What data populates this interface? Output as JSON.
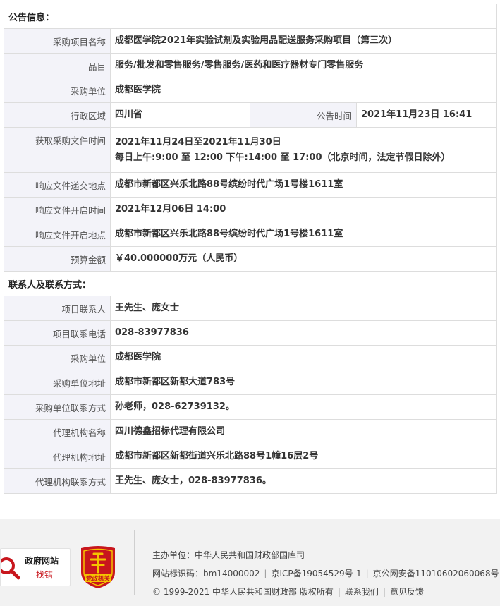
{
  "notice": {
    "section_title": "公告信息：",
    "project_name_label": "采购项目名称",
    "project_name": "成都医学院2021年实验试剂及实验用品配送服务采购项目（第三次）",
    "category_label": "品目",
    "category": "服务/批发和零售服务/零售服务/医药和医疗器材专门零售服务",
    "purchaser_label": "采购单位",
    "purchaser": "成都医学院",
    "region_label": "行政区域",
    "region": "四川省",
    "announce_time_label": "公告时间",
    "announce_time": "2021年11月23日 16:41",
    "doc_time_label": "获取采购文件时间",
    "doc_time_line1": "2021年11月24日至2021年11月30日",
    "doc_time_line2": "每日上午:9:00 至 12:00  下午:14:00 至 17:00（北京时间，法定节假日除外）",
    "submit_place_label": "响应文件递交地点",
    "submit_place": "成都市新都区兴乐北路88号缤纷时代广场1号楼1611室",
    "open_time_label": "响应文件开启时间",
    "open_time": "2021年12月06日 14:00",
    "open_place_label": "响应文件开启地点",
    "open_place": "成都市新都区兴乐北路88号缤纷时代广场1号楼1611室",
    "budget_label": "预算金额",
    "budget": "￥40.000000万元（人民币）"
  },
  "contacts": {
    "section_title": "联系人及联系方式：",
    "project_contact_label": "项目联系人",
    "project_contact": "王先生、庞女士",
    "project_phone_label": "项目联系电话",
    "project_phone": "028-83977836",
    "purchaser_label": "采购单位",
    "purchaser": "成都医学院",
    "purchaser_addr_label": "采购单位地址",
    "purchaser_addr": "成都市新都区新都大道783号",
    "purchaser_contact_label": "采购单位联系方式",
    "purchaser_contact": "孙老师，028-62739132。",
    "agency_name_label": "代理机构名称",
    "agency_name": "四川德鑫招标代理有限公司",
    "agency_addr_label": "代理机构地址",
    "agency_addr": "成都市新都区新都街道兴乐北路88号1幢16层2号",
    "agency_contact_label": "代理机构联系方式",
    "agency_contact": "王先生、庞女士，028-83977836。"
  },
  "footer": {
    "badge1_line1": "政府网站",
    "badge1_line2": "找错",
    "badge2_text": "党政机关",
    "sponsor": "主办单位：中华人民共和国财政部国库司",
    "site_id": "网站标识码：bm14000002",
    "icp": "京ICP备19054529号-1",
    "police": "京公网安备11010602060068号",
    "copyright": "© 1999-2021 中华人民共和国财政部 版权所有",
    "contact_us": "联系我们",
    "feedback": "意见反馈",
    "colors": {
      "red": "#c8161d",
      "gold": "#f5c400"
    }
  }
}
